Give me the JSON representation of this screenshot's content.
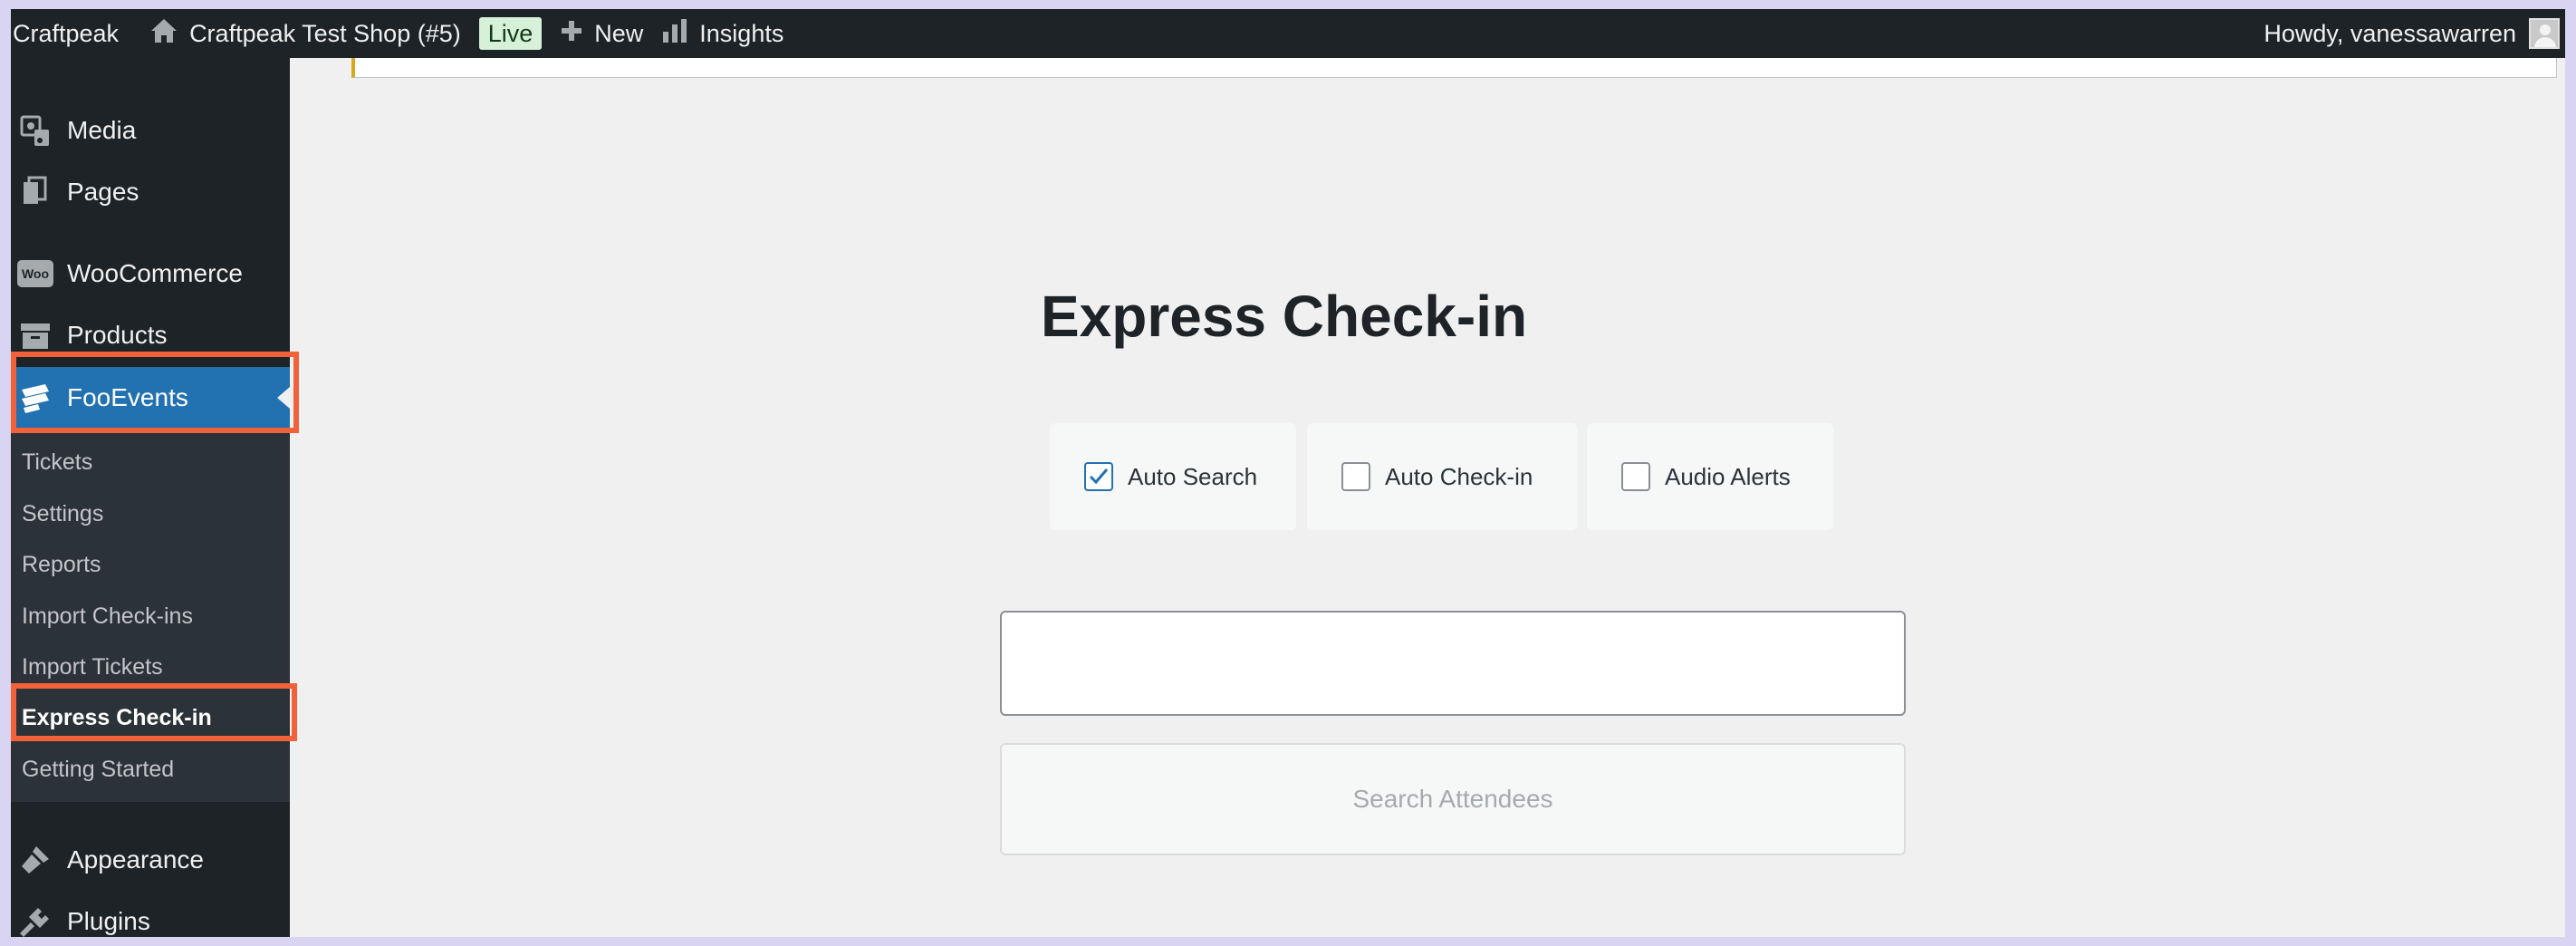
{
  "adminbar": {
    "site_name": "Craftpeak",
    "shop_name": "Craftpeak Test Shop (#5)",
    "live_badge": "Live",
    "new_label": "New",
    "insights_label": "Insights",
    "greeting": "Howdy, vanessawarren"
  },
  "sidebar": {
    "items": [
      {
        "label": "Media",
        "icon": "media-icon"
      },
      {
        "label": "Pages",
        "icon": "pages-icon"
      },
      {
        "label": "WooCommerce",
        "icon": "woocommerce-icon",
        "icon_text": "Woo"
      },
      {
        "label": "Products",
        "icon": "products-icon"
      },
      {
        "label": "FooEvents",
        "icon": "fooevents-icon",
        "active": true
      },
      {
        "label": "Appearance",
        "icon": "appearance-icon"
      },
      {
        "label": "Plugins",
        "icon": "plugins-icon"
      }
    ],
    "submenu": [
      {
        "label": "Tickets"
      },
      {
        "label": "Settings"
      },
      {
        "label": "Reports"
      },
      {
        "label": "Import Check-ins"
      },
      {
        "label": "Import Tickets"
      },
      {
        "label": "Express Check-in",
        "current": true
      },
      {
        "label": "Getting Started"
      }
    ]
  },
  "main": {
    "title": "Express Check-in",
    "options": [
      {
        "label": "Auto Search",
        "checked": true
      },
      {
        "label": "Auto Check-in",
        "checked": false
      },
      {
        "label": "Audio Alerts",
        "checked": false
      }
    ],
    "search_input_value": "",
    "search_button_label": "Search Attendees"
  },
  "colors": {
    "admin_bar": "#1d2327",
    "sidebar_active": "#2271b1",
    "highlight_box": "#f2623a",
    "live_badge_bg": "#d7f1d9",
    "notice_accent": "#dba617"
  }
}
